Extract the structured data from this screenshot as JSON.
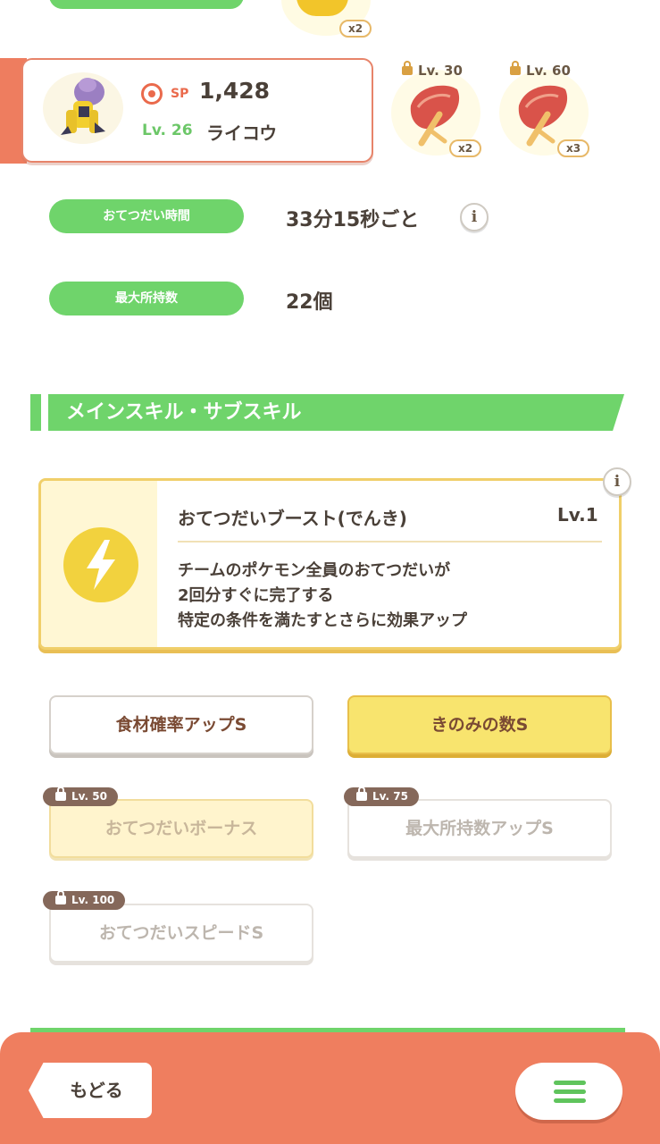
{
  "top_slot": {
    "qty": "x2"
  },
  "pokemon": {
    "sp_label": "SP",
    "sp_value": "1,428",
    "level_label": "Lv. 26",
    "name": "ライコウ"
  },
  "ingredient_slots": [
    {
      "lock_label": "Lv. 30",
      "qty": "x2",
      "icon": "leaf-icon"
    },
    {
      "lock_label": "Lv. 60",
      "qty": "x3",
      "icon": "leaf-icon"
    }
  ],
  "stats": [
    {
      "label": "おてつだい時間",
      "value": "33分15秒ごと"
    },
    {
      "label": "最大所持数",
      "value": "22個"
    }
  ],
  "section_title": "メインスキル・サブスキル",
  "main_skill": {
    "name": "おてつだいブースト(でんき)",
    "level": "Lv.1",
    "description": [
      "チームのポケモン全員のおてつだいが",
      "2回分すぐに完了する",
      "特定の条件を満たすとさらに効果アップ"
    ],
    "icon": "lightning-bolt-icon"
  },
  "sub_skills": [
    {
      "label": "食材確率アップS",
      "lock": null
    },
    {
      "label": "きのみの数S",
      "lock": null
    },
    {
      "label": "おてつだいボーナス",
      "lock": "Lv. 50"
    },
    {
      "label": "最大所持数アップS",
      "lock": "Lv. 75"
    },
    {
      "label": "おてつだいスピードS",
      "lock": "Lv. 100"
    }
  ],
  "info_glyph": "i",
  "bottom_bar": {
    "back_label": "もどる"
  },
  "colors": {
    "accent_green": "#6fd46b",
    "accent_orange": "#ef7e5f",
    "gold": "#f8e46e"
  }
}
